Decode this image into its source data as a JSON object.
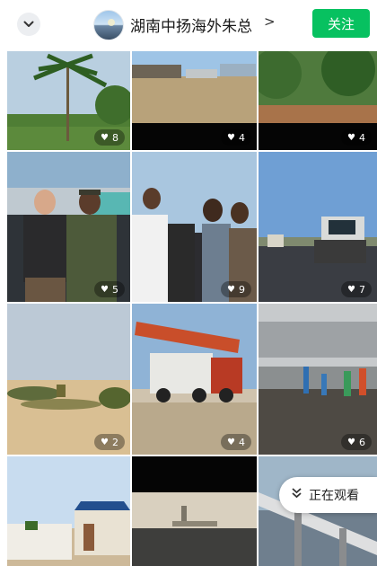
{
  "header": {
    "account_name": "湖南中扬海外朱总",
    "arrow": ">",
    "follow_label": "关注",
    "back_icon": "chevron-down-icon"
  },
  "accent_color": "#07c160",
  "posts": [
    {
      "likes": "8",
      "description": "palm trees"
    },
    {
      "likes": "4",
      "description": "site buildings"
    },
    {
      "likes": "4",
      "description": "road and trees"
    },
    {
      "likes": "5",
      "description": "two men posing"
    },
    {
      "likes": "9",
      "description": "group with camera"
    },
    {
      "likes": "7",
      "description": "road roller"
    },
    {
      "likes": "2",
      "description": "desert landscape"
    },
    {
      "likes": "4",
      "description": "drilling truck"
    },
    {
      "likes": "6",
      "description": "workshop workers"
    },
    {
      "likes": "",
      "description": "blue roof building"
    },
    {
      "likes": "",
      "description": "airfield"
    },
    {
      "likes": "",
      "description": "bridge"
    }
  ],
  "watching": {
    "label": "正在观看",
    "icon": "double-chevron-down-icon"
  }
}
